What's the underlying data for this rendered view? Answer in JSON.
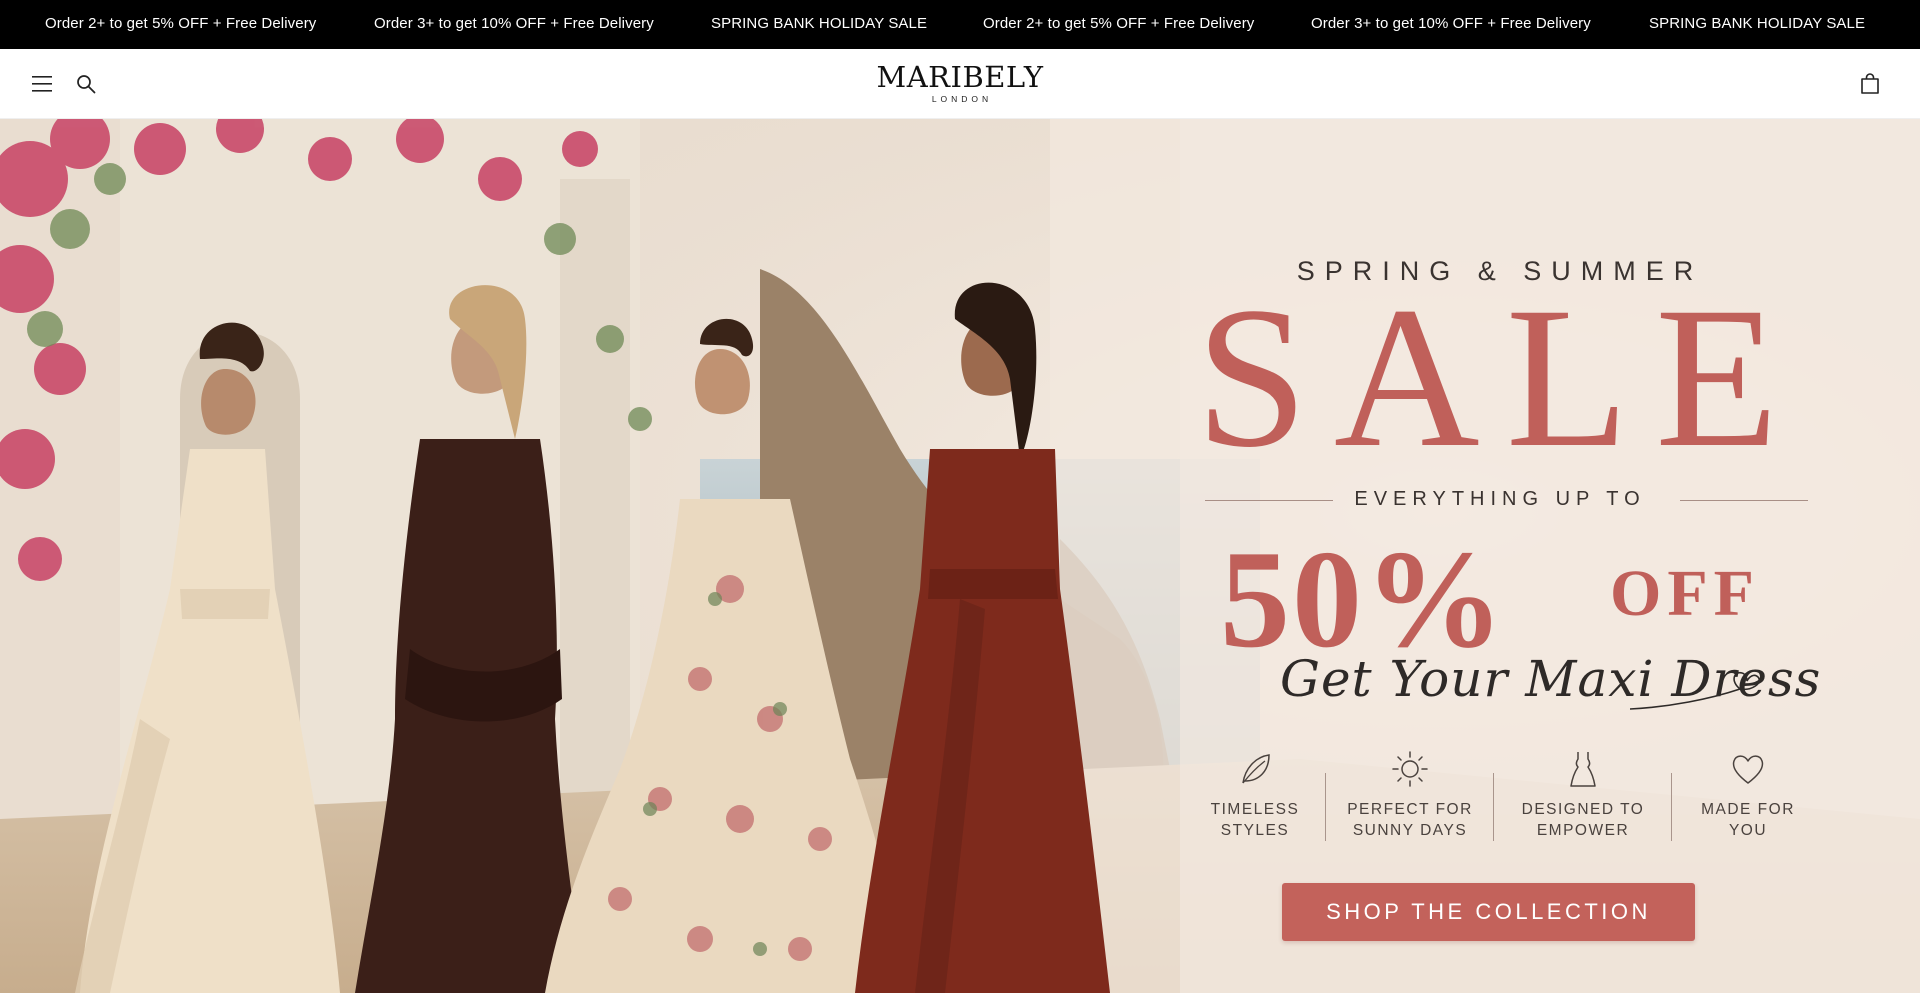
{
  "announcement_bar": {
    "messages": [
      "Order 2+ to get 5% OFF + Free Delivery",
      "Order 3+ to get 10% OFF + Free Delivery",
      "SPRING BANK HOLIDAY SALE",
      "Order 2+ to get 5% OFF + Free Delivery",
      "Order 3+ to get 10% OFF + Free Delivery",
      "SPRING BANK HOLIDAY SALE"
    ],
    "background": "#000000",
    "text_color": "#ffffff"
  },
  "header": {
    "menu_icon": "hamburger-menu-icon",
    "search_icon": "search-icon",
    "logo": {
      "brand": "MARIBELY",
      "city": "LONDON"
    },
    "cart_icon": "shopping-bag-icon"
  },
  "hero": {
    "kicker": "SPRING & SUMMER",
    "headline": "SALE",
    "subline": "EVERYTHING UP TO",
    "discount": "50%",
    "discount_suffix": "OFF",
    "script": "Get Your Maxi Dress",
    "features": [
      {
        "icon": "leaf-icon",
        "line1": "TIMELESS",
        "line2": "STYLES"
      },
      {
        "icon": "sun-icon",
        "line1": "PERFECT FOR",
        "line2": "SUNNY DAYS"
      },
      {
        "icon": "dress-icon",
        "line1": "DESIGNED TO",
        "line2": "EMPOWER"
      },
      {
        "icon": "heart-icon",
        "line1": "MADE FOR",
        "line2": "YOU"
      }
    ],
    "cta_label": "SHOP THE COLLECTION",
    "accent_color": "#c0605a",
    "dress_colors": [
      "#efe0c8",
      "#3b1f18",
      "#ead9c0",
      "#7e2a1c"
    ]
  }
}
